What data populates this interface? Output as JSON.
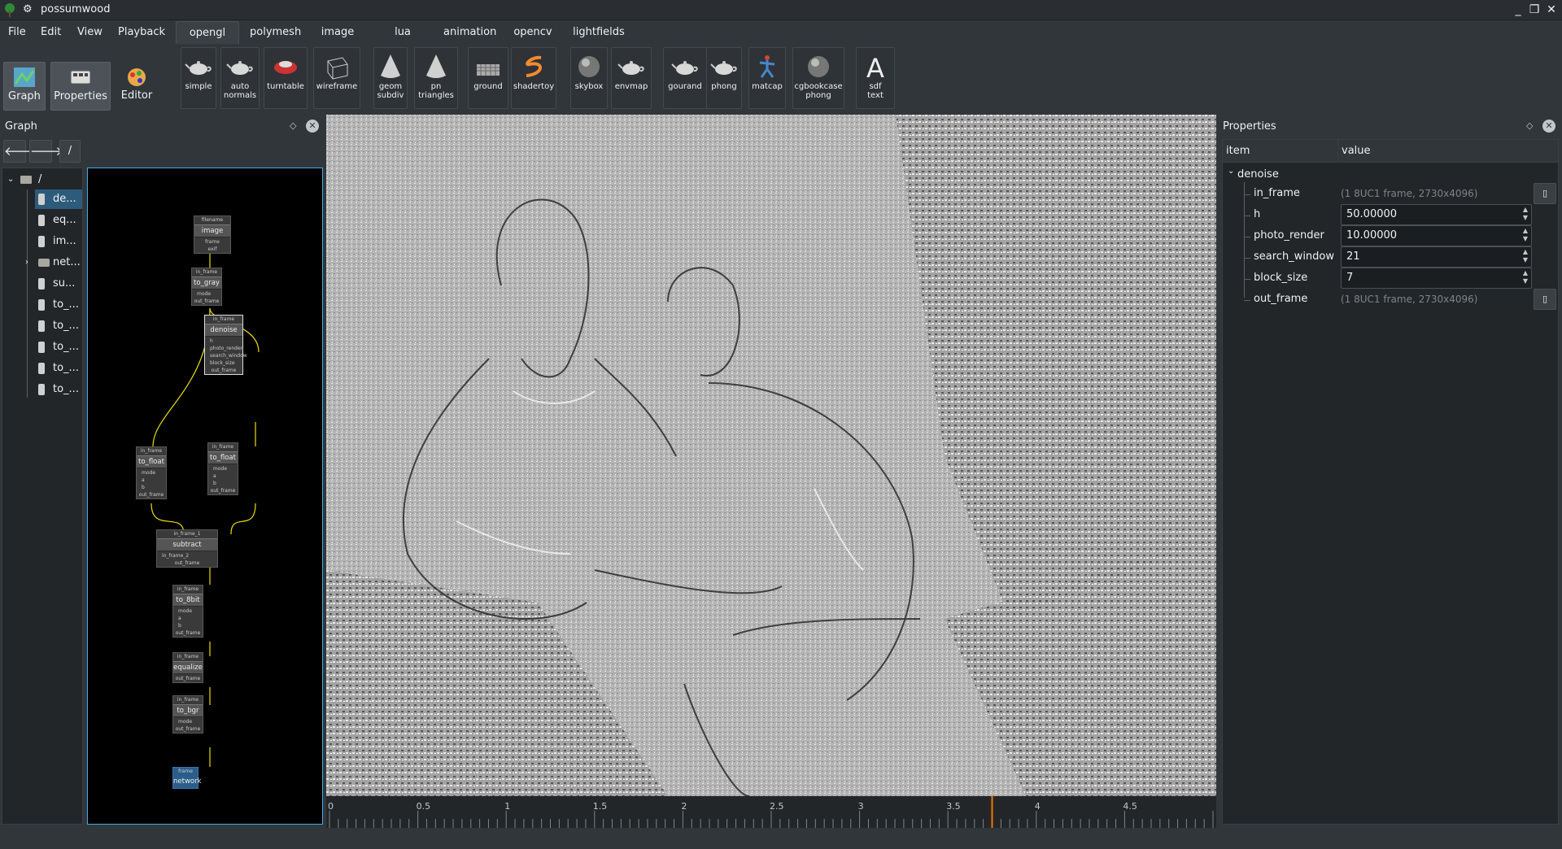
{
  "window": {
    "title": "possumwood",
    "minimize": "_",
    "restore": "❐",
    "close": "✕"
  },
  "menu": [
    "File",
    "Edit",
    "View",
    "Playback"
  ],
  "modes": [
    {
      "label": "Graph",
      "icon": "graph-icon",
      "active": true
    },
    {
      "label": "Properties",
      "icon": "properties-icon",
      "active": true
    },
    {
      "label": "Editor",
      "icon": "editor-icon",
      "active": false
    }
  ],
  "tabs": [
    "opengl",
    "polymesh",
    "image",
    "lua",
    "animation",
    "opencv",
    "lightfields"
  ],
  "active_tab": "opengl",
  "toolbar": [
    {
      "label": "simple",
      "icon": "teapot-icon"
    },
    {
      "label": "auto\nnormals",
      "icon": "teapot-icon"
    },
    {
      "label": "turntable",
      "icon": "car-icon"
    },
    {
      "label": "wireframe",
      "icon": "wireframe-cube-icon"
    },
    {
      "label": "geom\nsubdiv",
      "icon": "cone-icon"
    },
    {
      "label": "pn\ntriangles",
      "icon": "cone-icon"
    },
    {
      "label": "ground",
      "icon": "ground-icon"
    },
    {
      "label": "shadertoy",
      "icon": "shadertoy-icon"
    },
    {
      "label": "skybox",
      "icon": "sphere-icon"
    },
    {
      "label": "envmap",
      "icon": "teapot-icon"
    },
    {
      "label": "gourand",
      "icon": "teapot-icon"
    },
    {
      "label": "phong",
      "icon": "teapot-icon"
    },
    {
      "label": "matcap",
      "icon": "figure-icon"
    },
    {
      "label": "cgbookcase\nphong",
      "icon": "sphere-icon"
    },
    {
      "label": "sdf\ntext",
      "icon": "letter-a-icon"
    }
  ],
  "graph_panel": {
    "title": "Graph",
    "path": "/",
    "back": "🡐",
    "forward": "🡒",
    "tree_root": "/",
    "tree_items": [
      "de...",
      "eq...",
      "im...",
      "net...",
      "su...",
      "to_...",
      "to_...",
      "to_...",
      "to_...",
      "to_..."
    ],
    "selected_index": 0
  },
  "graph_nodes": [
    {
      "title": "image",
      "inputs": [
        "filename"
      ],
      "outputs": [
        "frame",
        "exif"
      ]
    },
    {
      "title": "to_gray",
      "inputs": [
        "in_frame",
        "mode"
      ],
      "outputs": [
        "out_frame"
      ]
    },
    {
      "title": "denoise",
      "inputs": [
        "in_frame",
        "h",
        "photo_render",
        "search_window",
        "block_size"
      ],
      "outputs": [
        "out_frame"
      ]
    },
    {
      "title": "to_float",
      "inputs": [
        "in_frame",
        "mode",
        "a",
        "b"
      ],
      "outputs": [
        "out_frame"
      ]
    },
    {
      "title": "to_float",
      "inputs": [
        "in_frame",
        "mode",
        "a",
        "b"
      ],
      "outputs": [
        "out_frame"
      ]
    },
    {
      "title": "subtract",
      "inputs": [
        "in_frame_1",
        "in_frame_2"
      ],
      "outputs": [
        "out_frame"
      ]
    },
    {
      "title": "to_8bit",
      "inputs": [
        "in_frame",
        "mode",
        "a",
        "b"
      ],
      "outputs": [
        "out_frame"
      ]
    },
    {
      "title": "equalize",
      "inputs": [
        "in_frame"
      ],
      "outputs": [
        "out_frame"
      ]
    },
    {
      "title": "to_bgr",
      "inputs": [
        "in_frame",
        "mode"
      ],
      "outputs": [
        "out_frame"
      ]
    },
    {
      "title": "network",
      "inputs": [
        "frame"
      ],
      "outputs": []
    }
  ],
  "timeline": {
    "ticks": [
      "0",
      "0.5",
      "1",
      "1.5",
      "2",
      "2.5",
      "3",
      "3.5",
      "4",
      "4.5"
    ],
    "playhead": 3.75
  },
  "properties_panel": {
    "title": "Properties",
    "col_item": "item",
    "col_value": "value",
    "node": "denoise",
    "rows": [
      {
        "name": "in_frame",
        "value": "(1 8UC1 frame, 2730x4096)",
        "editable": false
      },
      {
        "name": "h",
        "value": "50.00000",
        "editable": true
      },
      {
        "name": "photo_render",
        "value": "10.00000",
        "editable": true
      },
      {
        "name": "search_window",
        "value": "21",
        "editable": true
      },
      {
        "name": "block_size",
        "value": "7",
        "editable": true
      },
      {
        "name": "out_frame",
        "value": "(1 8UC1 frame, 2730x4096)",
        "editable": false
      }
    ]
  },
  "colors": {
    "accent": "#3daee9",
    "playhead": "#f67400",
    "wire": "#e8e000",
    "selection": "#2d5b7c"
  }
}
